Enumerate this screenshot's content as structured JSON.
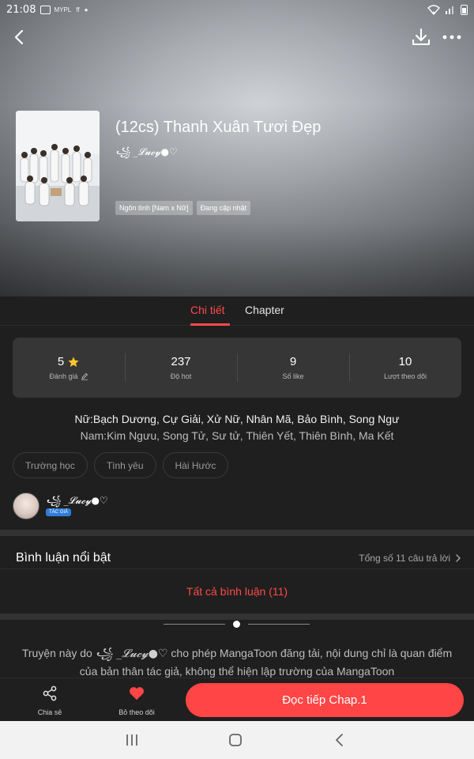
{
  "status_bar": {
    "time": "21:08",
    "small_text": "MYPL",
    "small_text2": "ff",
    "icons": [
      "wifi-icon",
      "signal-icon",
      "battery-icon"
    ]
  },
  "header": {
    "back_icon": "back-arrow-icon",
    "download_icon": "download-icon",
    "more_icon": "more-dots-icon"
  },
  "story": {
    "title": "(12cs) Thanh Xuân Tươi Đẹp",
    "author": "꧁ _𝓛𝓾𝓬𝔂●♡",
    "tags": [
      "Ngôn tình [Nam x Nữ]",
      "Đang cập nhật"
    ]
  },
  "tabs": [
    {
      "label": "Chi tiết",
      "active": true
    },
    {
      "label": "Chapter",
      "active": false
    }
  ],
  "stats": [
    {
      "value": "5",
      "label": "Đánh giá",
      "icon": "star-icon"
    },
    {
      "value": "237",
      "label": "Độ hot"
    },
    {
      "value": "9",
      "label": "Số like"
    },
    {
      "value": "10",
      "label": "Lượt theo dõi"
    }
  ],
  "description": {
    "line1": "Nữ:Bạch Dương, Cự Giải, Xử Nữ, Nhân Mã, Bảo Bình, Song Ngư",
    "line2": "Nam:Kim Ngưu, Song Tử, Sư tử, Thiên Yết, Thiên Bình, Ma Kết"
  },
  "genres": [
    "Trường học",
    "Tình yêu",
    "Hài Hước"
  ],
  "author_row": {
    "name": "꧁ _𝓛𝓾𝓬𝔂●♡",
    "badge": "TÁC GIẢ"
  },
  "comments": {
    "title": "Bình luận nổi bật",
    "count_label": "Tổng số 11 câu trả lời",
    "all_label": "Tất cả bình luận (11)"
  },
  "disclaimer": {
    "prefix": "Truyện này do ",
    "author": "꧁ _𝓛𝓾𝓬𝔂●♡",
    "suffix": " cho phép MangaToon đăng tải, nội dung chỉ là quan điểm của bản thân tác giả, không thể hiện lập trường của MangaToon"
  },
  "bottom_bar": {
    "share_label": "Chia sẻ",
    "unfollow_label": "Bỏ theo dõi",
    "read_label": "Đọc tiếp Chap.1"
  },
  "colors": {
    "accent": "#ff4545",
    "background": "#1f1f1f",
    "card": "#363636",
    "badge": "#2f7dd8"
  }
}
